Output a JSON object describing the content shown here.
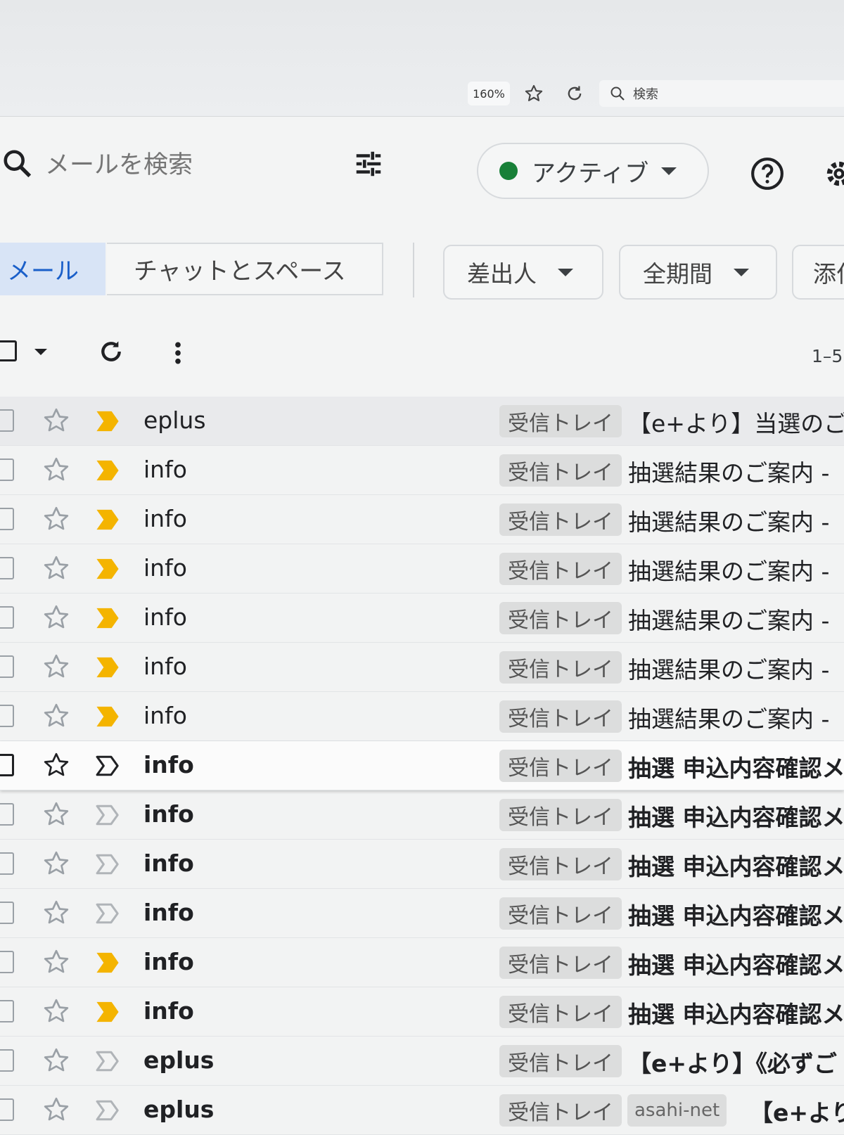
{
  "browser": {
    "zoom": "160%",
    "search_label": "検索"
  },
  "header": {
    "search_placeholder": "メールを検索",
    "status_label": "アクティブ",
    "status_color": "#188038"
  },
  "tabs": {
    "mail": "メール",
    "chat": "チャットとスペース"
  },
  "filters": {
    "sender": "差出人",
    "period": "全期間",
    "attachment": "添付"
  },
  "toolbar": {
    "count": "1–5"
  },
  "emails": [
    {
      "sender": "eplus",
      "label": "受信トレイ",
      "subject": "【e+より】当選のご",
      "important": true,
      "bold": false
    },
    {
      "sender": "info",
      "label": "受信トレイ",
      "subject": "抽選結果のご案内 -",
      "important": true,
      "bold": false
    },
    {
      "sender": "info",
      "label": "受信トレイ",
      "subject": "抽選結果のご案内 -",
      "important": true,
      "bold": false
    },
    {
      "sender": "info",
      "label": "受信トレイ",
      "subject": "抽選結果のご案内 -",
      "important": true,
      "bold": false
    },
    {
      "sender": "info",
      "label": "受信トレイ",
      "subject": "抽選結果のご案内 -",
      "important": true,
      "bold": false
    },
    {
      "sender": "info",
      "label": "受信トレイ",
      "subject": "抽選結果のご案内 -",
      "important": true,
      "bold": false
    },
    {
      "sender": "info",
      "label": "受信トレイ",
      "subject": "抽選結果のご案内 -",
      "important": true,
      "bold": false
    },
    {
      "sender": "info",
      "label": "受信トレイ",
      "subject": "抽選 申込内容確認メ",
      "important": false,
      "bold": true,
      "hover": true
    },
    {
      "sender": "info",
      "label": "受信トレイ",
      "subject": "抽選 申込内容確認メ",
      "important": false,
      "bold": true
    },
    {
      "sender": "info",
      "label": "受信トレイ",
      "subject": "抽選 申込内容確認メ",
      "important": false,
      "bold": true
    },
    {
      "sender": "info",
      "label": "受信トレイ",
      "subject": "抽選 申込内容確認メ",
      "important": false,
      "bold": true
    },
    {
      "sender": "info",
      "label": "受信トレイ",
      "subject": "抽選 申込内容確認メ",
      "important": true,
      "bold": true
    },
    {
      "sender": "info",
      "label": "受信トレイ",
      "subject": "抽選 申込内容確認メ",
      "important": true,
      "bold": true
    },
    {
      "sender": "eplus",
      "label": "受信トレイ",
      "subject": "【e+より】《必ずご",
      "important": false,
      "bold": true
    },
    {
      "sender": "eplus",
      "label": "受信トレイ",
      "label2": "asahi-net",
      "subject": "【e+より】",
      "important": false,
      "bold": true
    }
  ],
  "colors": {
    "important_marker": "#f4b400",
    "accent": "#1a5fc9"
  }
}
